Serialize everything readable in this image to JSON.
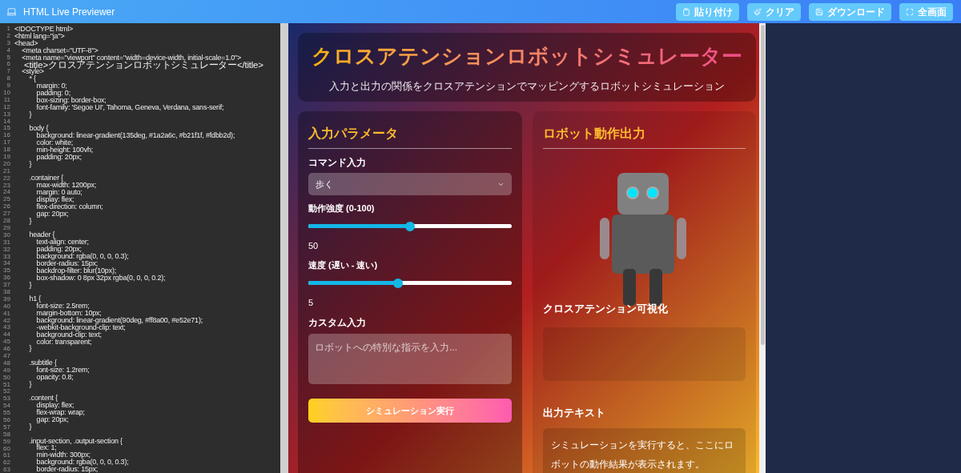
{
  "app_title": "HTML Live Previewer",
  "toolbar": [
    {
      "kind": "paste",
      "label": "貼り付け"
    },
    {
      "kind": "clear",
      "label": "クリア"
    },
    {
      "kind": "download",
      "label": "ダウンロード"
    },
    {
      "kind": "fullscreen",
      "label": "全画面"
    }
  ],
  "editor": {
    "lines": [
      {
        "number": "1",
        "code": "<!DOCTYPE html>"
      },
      {
        "number": "2",
        "code": "<html lang=\"ja\">"
      },
      {
        "number": "3",
        "code": "<head>"
      },
      {
        "number": "4",
        "code": "    <meta charset=\"UTF-8\">"
      },
      {
        "number": "5",
        "code": "    <meta name=\"viewport\" content=\"width=device-width, initial-scale=1.0\">"
      },
      {
        "number": "6",
        "code": "    <title>クロスアテンションロボットシミュレーター</title>"
      },
      {
        "number": "7",
        "code": "    <style>"
      },
      {
        "number": "8",
        "code": "        * {"
      },
      {
        "number": "9",
        "code": "            margin: 0;"
      },
      {
        "number": "10",
        "code": "            padding: 0;"
      },
      {
        "number": "11",
        "code": "            box-sizing: border-box;"
      },
      {
        "number": "12",
        "code": "            font-family: 'Segoe UI', Tahoma, Geneva, Verdana, sans-serif;"
      },
      {
        "number": "13",
        "code": "        }"
      },
      {
        "number": "14"
      },
      {
        "number": "15",
        "code": "        body {"
      },
      {
        "number": "16",
        "code": "            background: linear-gradient(135deg, #1a2a6c, #b21f1f, #fdbb2d);"
      },
      {
        "number": "17",
        "code": "            color: white;"
      },
      {
        "number": "18",
        "code": "            min-height: 100vh;"
      },
      {
        "number": "19",
        "code": "            padding: 20px;"
      },
      {
        "number": "20",
        "code": "        }"
      },
      {
        "number": "21"
      },
      {
        "number": "22",
        "code": "        .container {"
      },
      {
        "number": "23",
        "code": "            max-width: 1200px;"
      },
      {
        "number": "24",
        "code": "            margin: 0 auto;"
      },
      {
        "number": "25",
        "code": "            display: flex;"
      },
      {
        "number": "26",
        "code": "            flex-direction: column;"
      },
      {
        "number": "27",
        "code": "            gap: 20px;"
      },
      {
        "number": "28",
        "code": "        }"
      },
      {
        "number": "29"
      },
      {
        "number": "30",
        "code": "        header {"
      },
      {
        "number": "31",
        "code": "            text-align: center;"
      },
      {
        "number": "32",
        "code": "            padding: 20px;"
      },
      {
        "number": "33",
        "code": "            background: rgba(0, 0, 0, 0.3);"
      },
      {
        "number": "34",
        "code": "            border-radius: 15px;"
      },
      {
        "number": "35",
        "code": "            backdrop-filter: blur(10px);"
      },
      {
        "number": "36",
        "code": "            box-shadow: 0 8px 32px rgba(0, 0, 0, 0.2);"
      },
      {
        "number": "37",
        "code": "        }"
      },
      {
        "number": "38"
      },
      {
        "number": "39",
        "code": "        h1 {"
      },
      {
        "number": "40",
        "code": "            font-size: 2.5rem;"
      },
      {
        "number": "41",
        "code": "            margin-bottom: 10px;"
      },
      {
        "number": "42",
        "code": "            background: linear-gradient(90deg, #ff8a00, #e52e71);"
      },
      {
        "number": "43",
        "code": "            -webkit-background-clip: text;"
      },
      {
        "number": "44",
        "code": "            background-clip: text;"
      },
      {
        "number": "45",
        "code": "            color: transparent;"
      },
      {
        "number": "46",
        "code": "        }"
      },
      {
        "number": "47"
      },
      {
        "number": "48",
        "code": "        .subtitle {"
      },
      {
        "number": "49",
        "code": "            font-size: 1.2rem;"
      },
      {
        "number": "50",
        "code": "            opacity: 0.8;"
      },
      {
        "number": "51",
        "code": "        }"
      },
      {
        "number": "52"
      },
      {
        "number": "53",
        "code": "        .content {"
      },
      {
        "number": "54",
        "code": "            display: flex;"
      },
      {
        "number": "55",
        "code": "            flex-wrap: wrap;"
      },
      {
        "number": "56",
        "code": "            gap: 20px;"
      },
      {
        "number": "57",
        "code": "        }"
      },
      {
        "number": "58"
      },
      {
        "number": "59",
        "code": "        .input-section, .output-section {"
      },
      {
        "number": "60",
        "code": "            flex: 1;"
      },
      {
        "number": "61",
        "code": "            min-width: 300px;"
      },
      {
        "number": "62",
        "code": "            background: rgba(0, 0, 0, 0.3);"
      },
      {
        "number": "63",
        "code": "            border-radius: 15px;"
      }
    ]
  },
  "preview": {
    "title": "クロスアテンションロボットシミュレーター",
    "subtitle": "入力と出力の関係をクロスアテンションでマッピングするロボットシミュレーション",
    "input_panel": {
      "heading": "入力パラメータ",
      "command_label": "コマンド入力",
      "command_value": "歩く",
      "sliders": [
        {
          "label": "動作強度 (0-100)",
          "level": 0.5,
          "reading": "50"
        },
        {
          "label": "速度 (遅い - 速い)",
          "level": 0.44,
          "reading": "5"
        }
      ],
      "custom_label": "カスタム入力",
      "custom_placeholder": "ロボットへの特別な指示を入力...",
      "run_button": "シミュレーション実行"
    },
    "output_panel": {
      "heading": "ロボット動作出力",
      "viz_heading": "クロスアテンション可視化",
      "output_heading": "出力テキスト",
      "output_text": "シミュレーションを実行すると、ここにロボットの動作結果が表示されます。"
    }
  }
}
